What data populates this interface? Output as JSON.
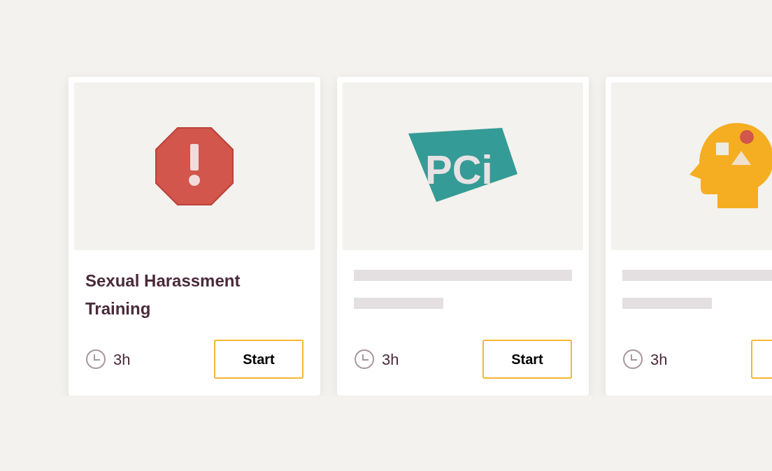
{
  "cards": [
    {
      "kind": "stop-sign",
      "loading": false,
      "title": "Sexual Harassment Training",
      "duration": "3h",
      "button": true,
      "button_label": "Start"
    },
    {
      "kind": "logo-badge",
      "logo_text": "PCi",
      "loading": true,
      "duration": "3h",
      "button": true,
      "button_label": "Start"
    },
    {
      "kind": "head",
      "loading": true,
      "duration": "3h",
      "button": true
    }
  ]
}
